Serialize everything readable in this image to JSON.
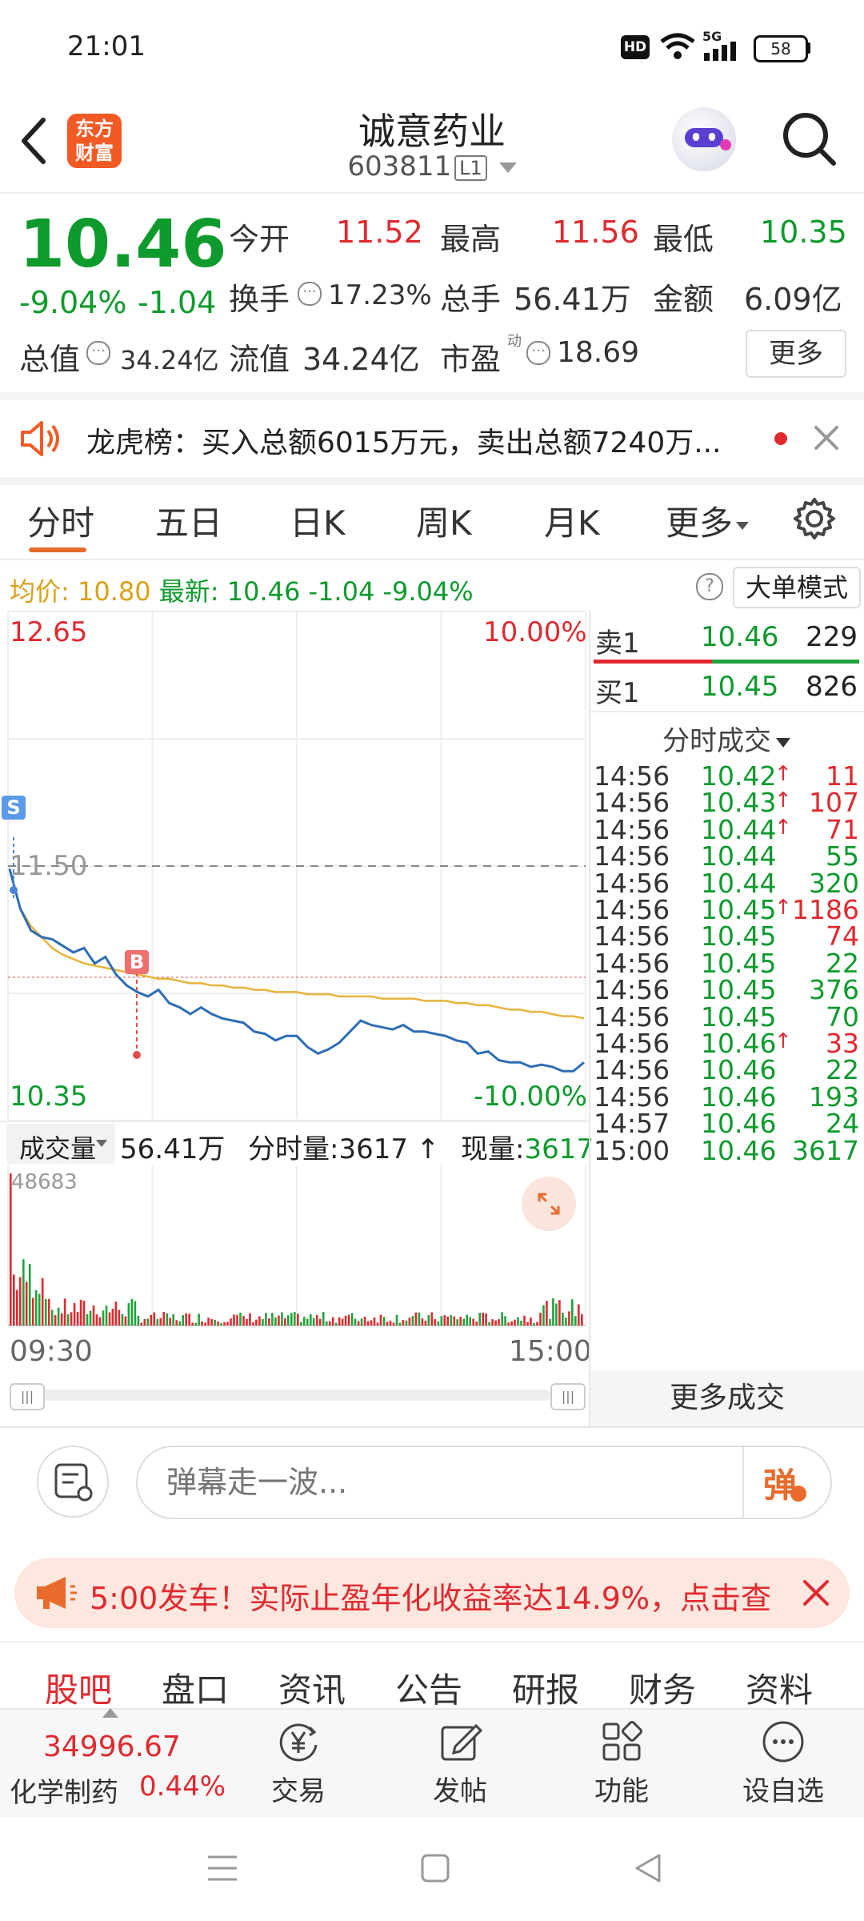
{
  "status_bar": {
    "time": "21:01",
    "network": "5G",
    "battery": "58"
  },
  "header": {
    "back_icon": "back-arrow-icon",
    "logo_text": "东方\n财富",
    "title": "诚意药业",
    "code": "603811",
    "level_badge": "L1"
  },
  "quote": {
    "price": "10.46",
    "change_pct": "-9.04%",
    "change": "-1.04",
    "open_label": "今开",
    "open": "11.52",
    "high_label": "最高",
    "high": "11.56",
    "low_label": "最低",
    "low": "10.35",
    "turnover_label": "换手",
    "turnover": "17.23%",
    "volume_label": "总手",
    "volume": "56.41万",
    "amount_label": "金额",
    "amount": "6.09亿",
    "mktcap_label": "总值",
    "mktcap": "34.24亿",
    "float_label": "流值",
    "float_cap": "34.24亿",
    "pe_label": "市盈",
    "pe_sup": "动",
    "pe": "18.69",
    "more_label": "更多"
  },
  "notice": {
    "text": "龙虎榜：买入总额6015万元，卖出总额7240万..."
  },
  "chart_tabs": [
    "分时",
    "五日",
    "日K",
    "周K",
    "月K",
    "更多"
  ],
  "info_line": {
    "avg_label": "均价:",
    "avg": "10.80",
    "latest_label": "最新:",
    "latest": "10.46",
    "change": "-1.04",
    "pct": "-9.04%",
    "mode_button": "大单模式"
  },
  "chart_labels": {
    "top_price": "12.65",
    "top_pct": "10.00%",
    "mid_price": "11.50",
    "bottom_price": "10.35",
    "bottom_pct": "-10.00%",
    "marker_s": "S",
    "marker_b": "B"
  },
  "volume_bar": {
    "label": "成交量",
    "total": "56.41万",
    "minute_label": "分时量:",
    "minute": "3617",
    "now_label": "现量:",
    "now": "3617",
    "max": "48683",
    "time_start": "09:30",
    "time_end": "15:00"
  },
  "orderbook": {
    "sell_label": "卖1",
    "sell_price": "10.46",
    "sell_vol": "229",
    "buy_label": "买1",
    "buy_price": "10.45",
    "buy_vol": "826",
    "trades_header": "分时成交",
    "more_trades": "更多成交"
  },
  "trades": [
    {
      "time": "14:56",
      "price": "10.42",
      "up": true,
      "vol": "11",
      "vol_color": "red"
    },
    {
      "time": "14:56",
      "price": "10.43",
      "up": true,
      "vol": "107",
      "vol_color": "red"
    },
    {
      "time": "14:56",
      "price": "10.44",
      "up": true,
      "vol": "71",
      "vol_color": "red"
    },
    {
      "time": "14:56",
      "price": "10.44",
      "up": false,
      "vol": "55",
      "vol_color": "green"
    },
    {
      "time": "14:56",
      "price": "10.44",
      "up": false,
      "vol": "320",
      "vol_color": "green"
    },
    {
      "time": "14:56",
      "price": "10.45",
      "up": true,
      "vol": "1186",
      "vol_color": "red"
    },
    {
      "time": "14:56",
      "price": "10.45",
      "up": false,
      "vol": "74",
      "vol_color": "red"
    },
    {
      "time": "14:56",
      "price": "10.45",
      "up": false,
      "vol": "22",
      "vol_color": "green"
    },
    {
      "time": "14:56",
      "price": "10.45",
      "up": false,
      "vol": "376",
      "vol_color": "green"
    },
    {
      "time": "14:56",
      "price": "10.45",
      "up": false,
      "vol": "70",
      "vol_color": "green"
    },
    {
      "time": "14:56",
      "price": "10.46",
      "up": true,
      "vol": "33",
      "vol_color": "red"
    },
    {
      "time": "14:56",
      "price": "10.46",
      "up": false,
      "vol": "22",
      "vol_color": "green"
    },
    {
      "time": "14:56",
      "price": "10.46",
      "up": false,
      "vol": "193",
      "vol_color": "green"
    },
    {
      "time": "14:57",
      "price": "10.46",
      "up": false,
      "vol": "24",
      "vol_color": "green"
    },
    {
      "time": "15:00",
      "price": "10.46",
      "up": false,
      "vol": "3617",
      "vol_color": "green"
    }
  ],
  "barrage": {
    "placeholder": "弹幕走一波...",
    "send_label": "弹"
  },
  "promo": {
    "text": "5:00发车！实际止盈年化收益率达14.9%，点击查"
  },
  "bottom_tabs": [
    "股吧",
    "盘口",
    "资讯",
    "公告",
    "研报",
    "财务",
    "资料"
  ],
  "footer": {
    "index_value": "34996.67",
    "sector": "化学制药",
    "sector_pct": "0.44%",
    "trade": "交易",
    "post": "发帖",
    "func": "功能",
    "watch": "设自选"
  },
  "chart_data": {
    "type": "line",
    "y_range": [
      10.35,
      12.65
    ],
    "x_range": [
      "09:30",
      "15:00"
    ],
    "reference_price": 11.5,
    "series": [
      {
        "name": "最新",
        "color": "#2f6db5",
        "values": [
          11.48,
          11.3,
          11.2,
          11.17,
          11.16,
          11.13,
          11.1,
          11.12,
          11.05,
          11.08,
          11.0,
          10.95,
          10.92,
          10.9,
          10.93,
          10.87,
          10.85,
          10.82,
          10.85,
          10.82,
          10.8,
          10.79,
          10.78,
          10.74,
          10.73,
          10.7,
          10.72,
          10.72,
          10.67,
          10.64,
          10.66,
          10.69,
          10.74,
          10.79,
          10.77,
          10.76,
          10.75,
          10.77,
          10.74,
          10.74,
          10.73,
          10.72,
          10.7,
          10.69,
          10.64,
          10.65,
          10.61,
          10.6,
          10.6,
          10.58,
          10.59,
          10.58,
          10.56,
          10.56,
          10.6
        ]
      },
      {
        "name": "均价",
        "color": "#e8b43c",
        "values": [
          11.48,
          11.3,
          11.22,
          11.17,
          11.12,
          11.09,
          11.07,
          11.05,
          11.04,
          11.03,
          11.02,
          11.01,
          11.0,
          10.99,
          10.98,
          10.98,
          10.97,
          10.96,
          10.96,
          10.95,
          10.95,
          10.94,
          10.94,
          10.93,
          10.93,
          10.92,
          10.92,
          10.92,
          10.91,
          10.91,
          10.91,
          10.9,
          10.9,
          10.9,
          10.9,
          10.89,
          10.89,
          10.89,
          10.89,
          10.88,
          10.88,
          10.88,
          10.87,
          10.87,
          10.86,
          10.86,
          10.85,
          10.84,
          10.84,
          10.83,
          10.83,
          10.82,
          10.81,
          10.81,
          10.8
        ]
      }
    ]
  }
}
